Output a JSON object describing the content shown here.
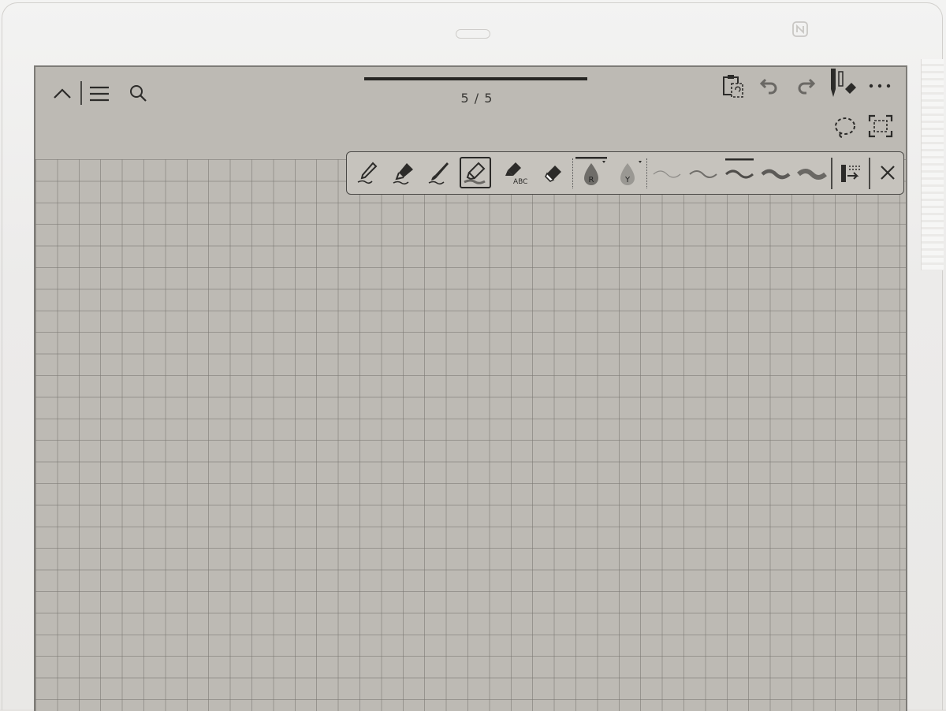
{
  "page_counter": "5 / 5",
  "progress": 1.0,
  "toolbar": {
    "left": [
      {
        "name": "chevron-up-icon",
        "interactable": true
      },
      {
        "name": "menu-icon",
        "interactable": true
      },
      {
        "name": "search-icon",
        "interactable": true
      }
    ],
    "right": [
      {
        "name": "paste-icon",
        "interactable": true
      },
      {
        "name": "undo-icon",
        "interactable": true
      },
      {
        "name": "redo-icon",
        "interactable": true
      },
      {
        "name": "pen-eraser-icon",
        "interactable": true
      },
      {
        "name": "more-icon",
        "interactable": true
      }
    ],
    "secondary": [
      {
        "name": "lasso-select-icon",
        "interactable": true
      },
      {
        "name": "fullscreen-icon",
        "interactable": true
      }
    ]
  },
  "pen_toolbar": {
    "tools": [
      {
        "name": "ballpoint-pen-icon",
        "selected": false
      },
      {
        "name": "fountain-pen-icon",
        "selected": false
      },
      {
        "name": "brush-pen-icon",
        "selected": false
      },
      {
        "name": "highlighter-icon",
        "selected": true
      },
      {
        "name": "text-marker-icon",
        "label": "ABC",
        "selected": false
      },
      {
        "name": "eraser-icon",
        "selected": false
      }
    ],
    "colors": [
      {
        "name": "color-red-drop",
        "letter": "R",
        "selected": true,
        "color": "#6f6d69"
      },
      {
        "name": "color-yellow-drop",
        "letter": "Y",
        "selected": false,
        "color": "#9a9893"
      }
    ],
    "thickness_levels": 5,
    "selected_thickness": 3,
    "close_icon": "close-icon"
  },
  "colors": {
    "screen": "#bdbab4",
    "ink": "#262523",
    "grid": "#787570"
  }
}
